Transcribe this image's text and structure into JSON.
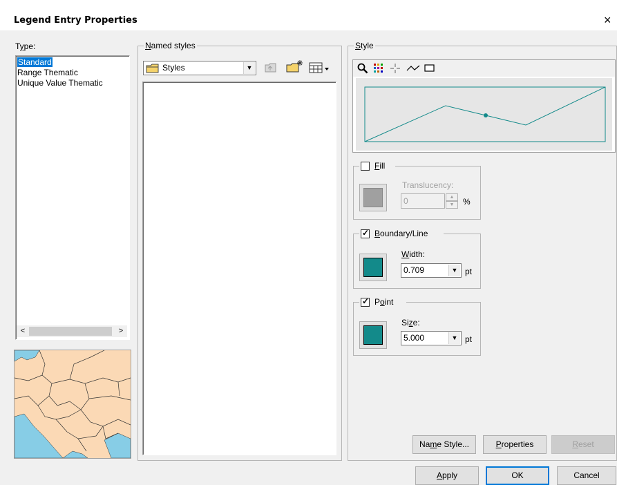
{
  "window": {
    "title": "Legend Entry Properties",
    "close_symbol": "×"
  },
  "type_group": {
    "label_prefix": "T",
    "label_accel": "y",
    "label_suffix": "pe:",
    "items": [
      {
        "label": "Standard",
        "selected": true
      },
      {
        "label": "Range Thematic",
        "selected": false
      },
      {
        "label": "Unique Value Thematic",
        "selected": false
      }
    ],
    "scroll_left": "<",
    "scroll_right": ">"
  },
  "named_styles": {
    "label_accel": "N",
    "label_rest": "amed styles",
    "folder_value": "Styles"
  },
  "style_group": {
    "label_accel": "S",
    "label_rest": "tyle",
    "colors": {
      "line": "#138a8a",
      "fill_swatch": "#a0a0a0",
      "line_swatch": "#138a8a",
      "point_swatch": "#138a8a"
    }
  },
  "fill": {
    "label_accel": "F",
    "label_rest": "ill",
    "checked": false,
    "translucency_label": "Translucency:",
    "translucency_value": "0",
    "unit": "%"
  },
  "boundary": {
    "label_accel": "B",
    "label_rest": "oundary/Line",
    "checked": true,
    "width_label": "Width:",
    "width_value": "0.709",
    "unit": "pt"
  },
  "point": {
    "label_pre": "P",
    "label_accel": "o",
    "label_rest": "int",
    "checked": true,
    "size_label": "Size:",
    "size_value": "5.000",
    "unit": "pt"
  },
  "buttons": {
    "name_style_pre": "Na",
    "name_style_accel": "m",
    "name_style_rest": "e Style...",
    "properties_accel": "P",
    "properties_rest": "roperties",
    "reset_accel": "R",
    "reset_rest": "eset",
    "apply_accel": "A",
    "apply_rest": "pply",
    "ok": "OK",
    "cancel": "Cancel"
  }
}
